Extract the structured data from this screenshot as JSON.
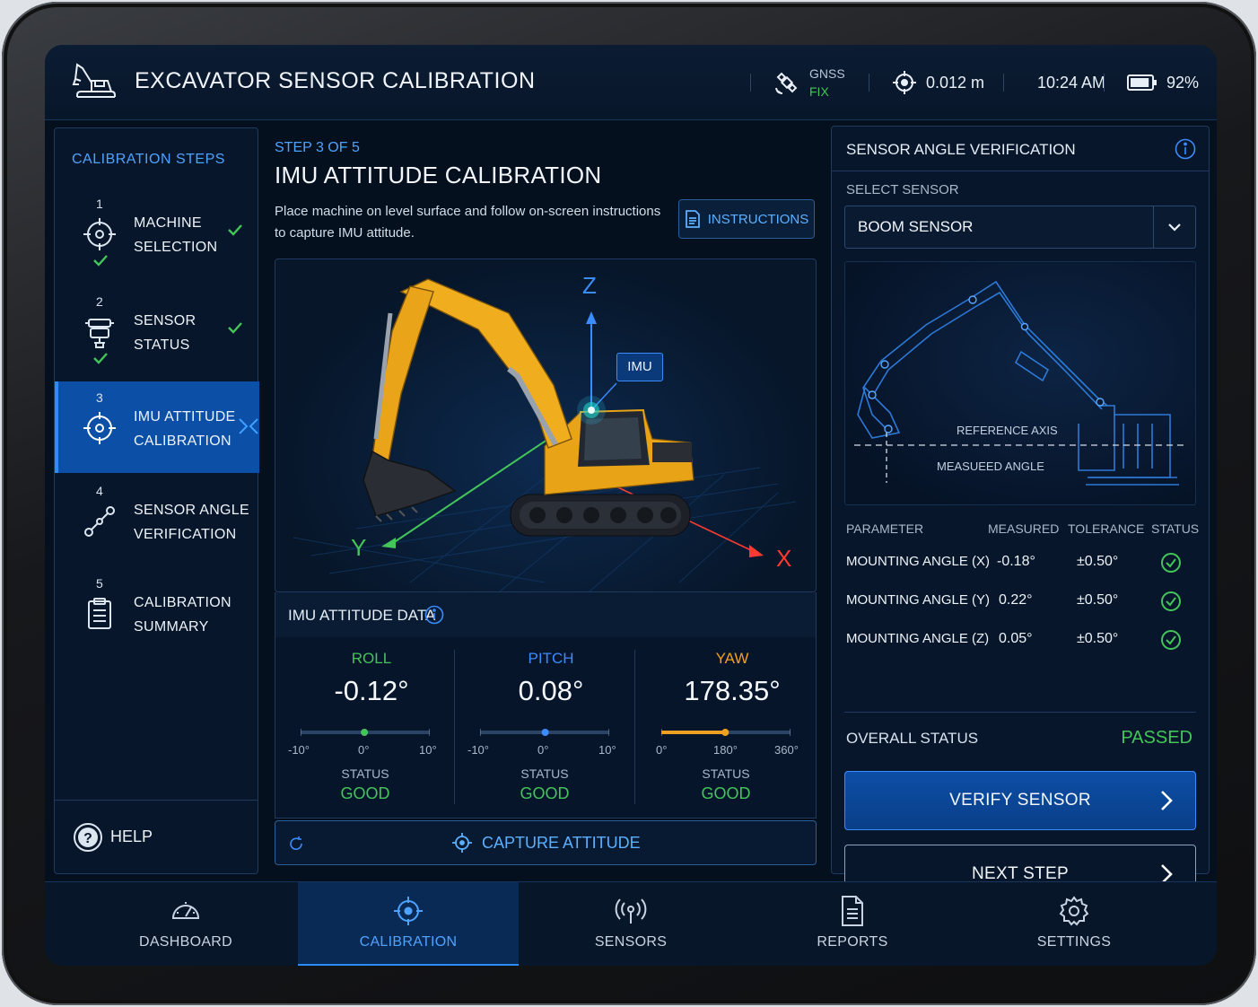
{
  "header": {
    "title": "EXCAVATOR SENSOR CALIBRATION",
    "gnss_label": "GNSS",
    "gnss_status": "FIX",
    "accuracy": "0.012 m",
    "time": "10:24 AM",
    "battery": "92%",
    "battery_level": 0.92
  },
  "sidebar": {
    "title": "CALIBRATION STEPS",
    "steps": [
      {
        "num": "1",
        "line1": "MACHINE",
        "line2": "SELECTION",
        "icon": "crosshair-icon",
        "done": true
      },
      {
        "num": "2",
        "line1": "SENSOR",
        "line2": "STATUS",
        "icon": "sensor-icon",
        "done": true
      },
      {
        "num": "3",
        "line1": "IMU ATTITUDE",
        "line2": "CALIBRATION",
        "icon": "crosshair-icon",
        "active": true
      },
      {
        "num": "4",
        "line1": "SENSOR ANGLE",
        "line2": "VERIFICATION",
        "icon": "linkage-icon"
      },
      {
        "num": "5",
        "line1": "CALIBRATION",
        "line2": "SUMMARY",
        "icon": "clipboard-icon"
      }
    ],
    "help": "HELP"
  },
  "main": {
    "step_of": "STEP 3 OF 5",
    "title": "IMU ATTITUDE CALIBRATION",
    "desc_line1": "Place machine on level surface and follow on-screen instructions",
    "desc_line2": "to capture IMU attitude.",
    "instructions_button": "INSTRUCTIONS",
    "viewer": {
      "imu_tag": "IMU",
      "axis_z": "Z",
      "axis_y": "Y",
      "axis_x": "X"
    },
    "imu_data_title": "IMU ATTITUDE DATA",
    "readings": [
      {
        "name": "ROLL",
        "value": "-0.12°",
        "ticks": [
          "-10°",
          "0°",
          "10°"
        ],
        "status_label": "STATUS",
        "status": "GOOD",
        "color": "#43c55a",
        "min": -10,
        "max": 10,
        "raw": -0.12
      },
      {
        "name": "PITCH",
        "value": "0.08°",
        "ticks": [
          "-10°",
          "0°",
          "10°"
        ],
        "status_label": "STATUS",
        "status": "GOOD",
        "color": "#3b8cff",
        "min": -10,
        "max": 10,
        "raw": 0.08
      },
      {
        "name": "YAW",
        "value": "178.35°",
        "ticks": [
          "0°",
          "180°",
          "360°"
        ],
        "status_label": "STATUS",
        "status": "GOOD",
        "color": "#f0a020",
        "min": 0,
        "max": 360,
        "raw": 178.35
      }
    ],
    "capture_button": "CAPTURE ATTITUDE"
  },
  "right": {
    "title": "SENSOR ANGLE VERIFICATION",
    "select_label": "SELECT SENSOR",
    "selected_sensor": "BOOM SENSOR",
    "diagram_ref": "REFERENCE AXIS",
    "diagram_meas": "MEASUEED ANGLE",
    "table_headers": [
      "PARAMETER",
      "MEASURED",
      "TOLERANCE",
      "STATUS"
    ],
    "rows": [
      {
        "param": "MOUNTING ANGLE (X)",
        "measured": "-0.18°",
        "tolerance": "±0.50°"
      },
      {
        "param": "MOUNTING ANGLE (Y)",
        "measured": "0.22°",
        "tolerance": "±0.50°"
      },
      {
        "param": "MOUNTING ANGLE (Z)",
        "measured": "0.05°",
        "tolerance": "±0.50°"
      }
    ],
    "overall_label": "OVERALL STATUS",
    "overall_value": "PASSED",
    "verify_button": "VERIFY SENSOR",
    "next_button": "NEXT STEP"
  },
  "nav": [
    {
      "label": "DASHBOARD",
      "icon": "gauge-icon"
    },
    {
      "label": "CALIBRATION",
      "icon": "crosshair-icon",
      "active": true
    },
    {
      "label": "SENSORS",
      "icon": "antenna-icon"
    },
    {
      "label": "REPORTS",
      "icon": "document-icon"
    },
    {
      "label": "SETTINGS",
      "icon": "gear-icon"
    }
  ]
}
